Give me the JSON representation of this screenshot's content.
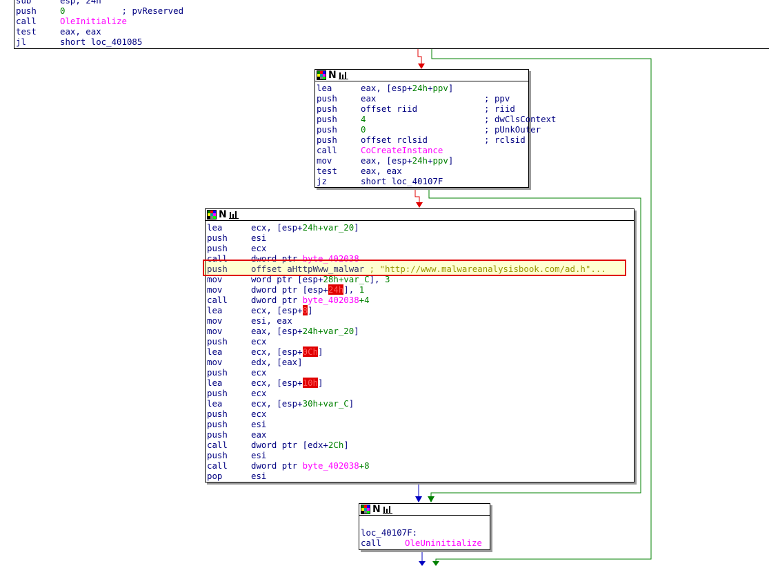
{
  "colors": {
    "true_edge": "#008000",
    "false_edge": "#e00000",
    "normal_edge": "#0000c0",
    "highlight": "#e00000"
  },
  "header_icons": [
    "grid-icon",
    "n-icon",
    "graph-icon"
  ],
  "header_n": "N",
  "block1": {
    "lines": [
      {
        "m": "sub",
        "o": "esp, 24h"
      },
      {
        "m": "push",
        "o": "0",
        "c": "; pvReserved"
      },
      {
        "m": "call",
        "o": "OleInitialize"
      },
      {
        "m": "test",
        "o": "eax, eax"
      },
      {
        "m": "jl",
        "o": "short loc_401085"
      }
    ]
  },
  "block2": {
    "lines": [
      {
        "m": "lea",
        "o1": "eax, [esp+",
        "o2": "24h",
        "o3": "+",
        "o4": "ppv",
        "o5": "]"
      },
      {
        "m": "push",
        "o": "eax",
        "c": "; ppv"
      },
      {
        "m": "push",
        "o": "offset riid",
        "c": "; riid"
      },
      {
        "m": "push",
        "o": "4",
        "c": "; dwClsContext"
      },
      {
        "m": "push",
        "o": "0",
        "c": "; pUnkOuter"
      },
      {
        "m": "push",
        "o": "offset rclsid",
        "c": "; rclsid"
      },
      {
        "m": "call",
        "o": "CoCreateInstance"
      },
      {
        "m": "mov",
        "o1": "eax, [esp+",
        "o2": "24h",
        "o3": "+",
        "o4": "ppv",
        "o5": "]"
      },
      {
        "m": "test",
        "o": "eax, eax"
      },
      {
        "m": "jz",
        "o": "short loc_40107F"
      }
    ]
  },
  "block3": {
    "lines": [
      {
        "m": "lea",
        "a": "ecx, [esp+",
        "b": "24h",
        "c": "+var_20",
        "d": "]"
      },
      {
        "m": "push",
        "a": "esi"
      },
      {
        "m": "push",
        "a": "ecx"
      },
      {
        "m": "call",
        "a": "dword ptr ",
        "f": "byte_402038"
      },
      {
        "m": "push",
        "a": "offset aHttpWww_malwar",
        "s": " ; \"http://www.malwareanalysisbook.com/ad.h\"..."
      },
      {
        "m": "mov",
        "a": "word ptr [esp+",
        "b": "28h",
        "c": "+var_C",
        "d": "], ",
        "e": "3"
      },
      {
        "m": "mov",
        "a": "dword ptr [esp+",
        "x": "24h",
        "d": "], ",
        "e": "1"
      },
      {
        "m": "call",
        "a": "dword ptr ",
        "f": "byte_402038",
        "g": "+4"
      },
      {
        "m": "lea",
        "a": "ecx, [esp+",
        "x": "8",
        "d": "]"
      },
      {
        "m": "mov",
        "a": "esi, eax"
      },
      {
        "m": "mov",
        "a": "eax, [esp+",
        "b": "24h",
        "c": "+var_20",
        "d": "]"
      },
      {
        "m": "push",
        "a": "ecx"
      },
      {
        "m": "lea",
        "a": "ecx, [esp+",
        "x": "0Ch",
        "d": "]"
      },
      {
        "m": "mov",
        "a": "edx, [eax]"
      },
      {
        "m": "push",
        "a": "ecx"
      },
      {
        "m": "lea",
        "a": "ecx, [esp+",
        "x": "10h",
        "d": "]"
      },
      {
        "m": "push",
        "a": "ecx"
      },
      {
        "m": "lea",
        "a": "ecx, [esp+",
        "b": "30h",
        "c": "+var_C",
        "d": "]"
      },
      {
        "m": "push",
        "a": "ecx"
      },
      {
        "m": "push",
        "a": "esi"
      },
      {
        "m": "push",
        "a": "eax"
      },
      {
        "m": "call",
        "a": "dword ptr [edx+",
        "b": "2Ch",
        "d": "]"
      },
      {
        "m": "push",
        "a": "esi"
      },
      {
        "m": "call",
        "a": "dword ptr ",
        "f": "byte_402038",
        "g": "+8"
      },
      {
        "m": "pop",
        "a": "esi"
      }
    ]
  },
  "block4": {
    "label": "loc_40107F:",
    "call_m": "call",
    "call_o": "OleUninitialize"
  }
}
